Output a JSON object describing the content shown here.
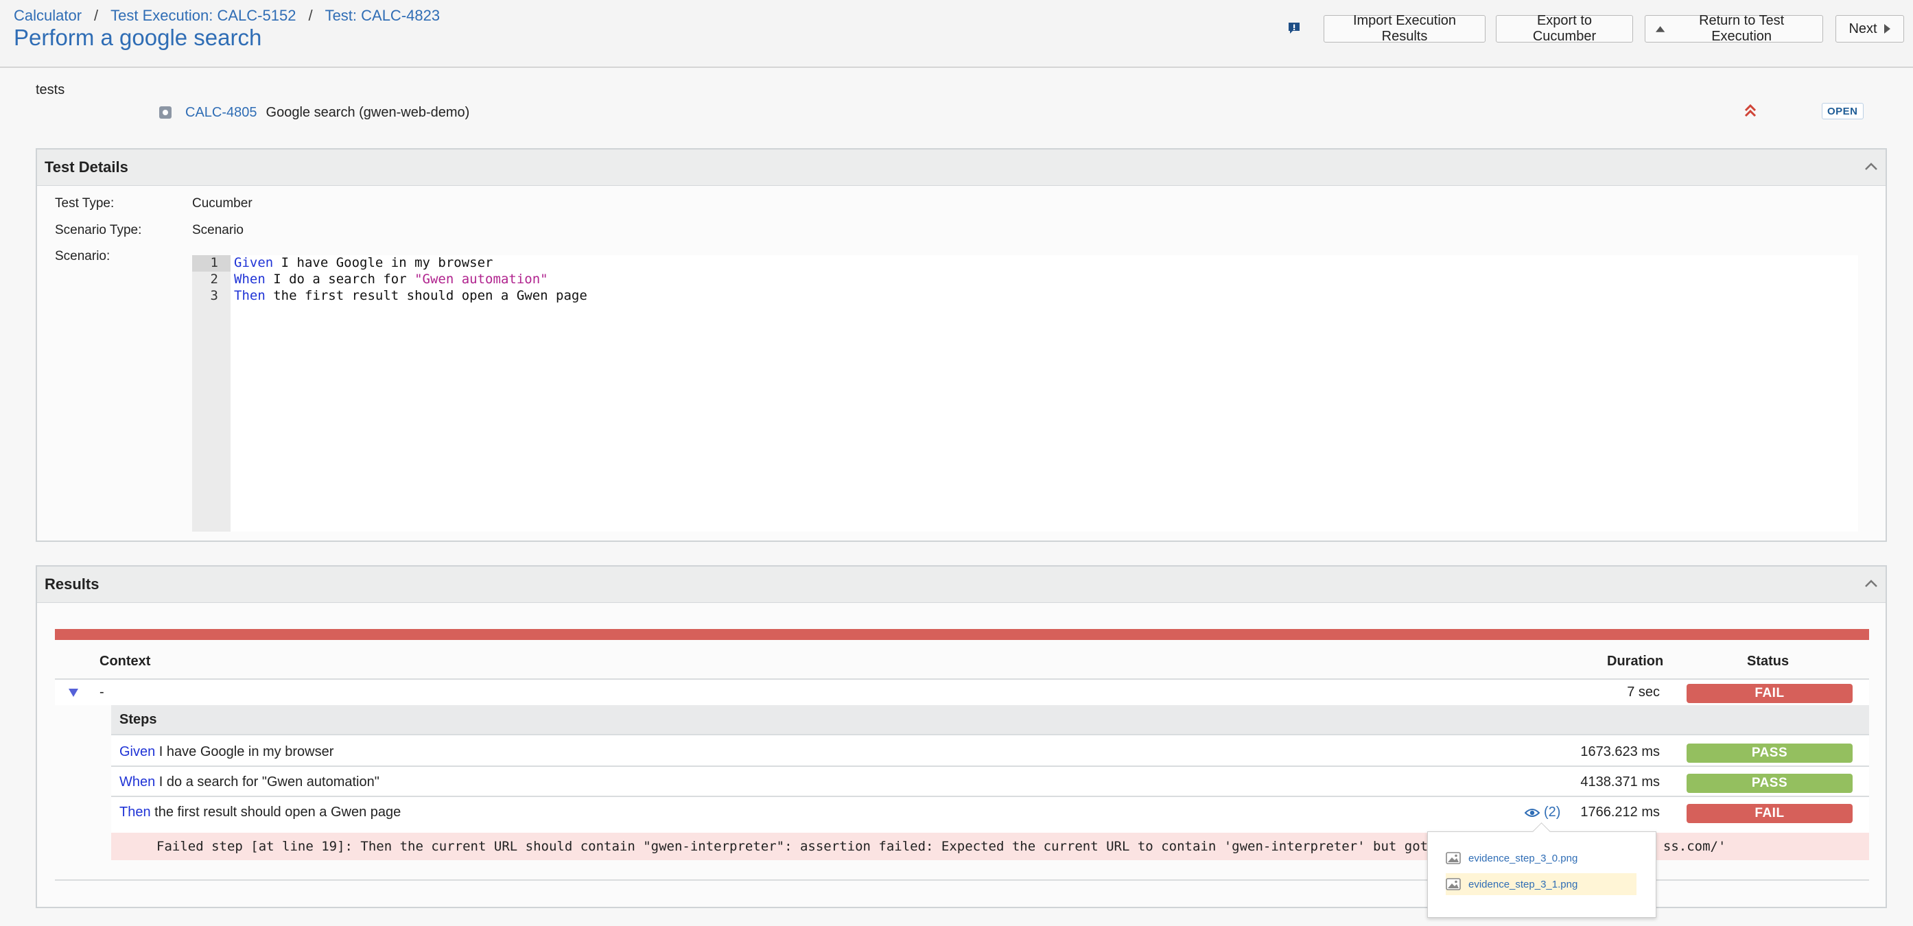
{
  "breadcrumb": {
    "project": "Calculator",
    "execution": "Test Execution: CALC-5152",
    "test": "Test: CALC-4823"
  },
  "page_title": "Perform a google search",
  "toolbar": {
    "import_label": "Import Execution Results",
    "export_label": "Export to Cucumber",
    "return_label": "Return to Test Execution",
    "next_label": "Next"
  },
  "tests_section": {
    "label": "tests",
    "issue_key": "CALC-4805",
    "issue_summary": "Google search (gwen-web-demo)",
    "status": "OPEN",
    "priority_color": "#d04437"
  },
  "test_details": {
    "title": "Test Details",
    "test_type_label": "Test Type:",
    "test_type_value": "Cucumber",
    "scenario_type_label": "Scenario Type:",
    "scenario_type_value": "Scenario",
    "scenario_label": "Scenario:",
    "code": [
      {
        "no": "1",
        "kw": "Given",
        "text": " I have Google in my browser",
        "str": ""
      },
      {
        "no": "2",
        "kw": "When",
        "text": " I do a search for ",
        "str": "\"Gwen automation\""
      },
      {
        "no": "3",
        "kw": "Then",
        "text": " the first result should open a Gwen page",
        "str": ""
      }
    ]
  },
  "results": {
    "title": "Results",
    "col_context": "Context",
    "col_duration": "Duration",
    "col_status": "Status",
    "context_row": {
      "context": "-",
      "duration": "7 sec",
      "status": "FAIL"
    },
    "steps_label": "Steps",
    "steps": [
      {
        "kw": "Given",
        "text": " I have Google in my browser",
        "duration": "1673.623 ms",
        "status": "PASS"
      },
      {
        "kw": "When",
        "text": " I do a search for \"Gwen automation\"",
        "duration": "4138.371 ms",
        "status": "PASS"
      },
      {
        "kw": "Then",
        "text": " the first result should open a Gwen page",
        "duration": "1766.212 ms",
        "status": "FAIL"
      }
    ],
    "evidence_count": "(2)",
    "error_part1": "Failed step [at line 19]: Then the current URL should contain \"gwen-interpreter\": assertion failed: Expected the current URL to contain 'gwen-interpreter' but got 'ht",
    "error_part2": "ss.com/'",
    "evidence_files": [
      "evidence_step_3_0.png",
      "evidence_step_3_1.png"
    ],
    "colors": {
      "fail": "#d6605a",
      "pass": "#94bf5f"
    }
  }
}
